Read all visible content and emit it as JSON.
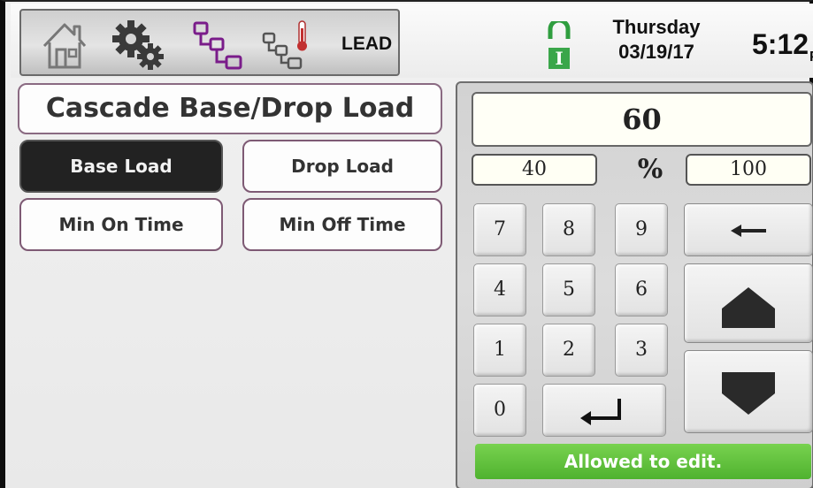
{
  "header": {
    "mode_label": "LEAD",
    "day": "Thursday",
    "date": "03/19/17",
    "time": "5:12",
    "time_suffix": "PM",
    "status_icon_letter": "I",
    "status_color": "#3aa64a"
  },
  "page": {
    "title": "Cascade Base/Drop Load"
  },
  "menu": {
    "base_load": "Base Load",
    "drop_load": "Drop Load",
    "min_on_time": "Min On Time",
    "min_off_time": "Min Off Time",
    "selected": "Base Load"
  },
  "keypad": {
    "value": "60",
    "min": "40",
    "max": "100",
    "unit": "%",
    "keys": {
      "k7": "7",
      "k8": "8",
      "k9": "9",
      "k4": "4",
      "k5": "5",
      "k6": "6",
      "k1": "1",
      "k2": "2",
      "k3": "3",
      "k0": "0"
    },
    "edit_status": "Allowed to edit.",
    "edit_status_color": "#5cc23a"
  },
  "icons": {
    "home": "home-icon",
    "settings": "gear-icon",
    "cascade": "cascade-icon",
    "cascade_temp": "cascade-temperature-icon",
    "status": "input-status-icon",
    "backspace": "arrow-left-icon",
    "enter": "enter-icon",
    "up": "arrow-up-icon",
    "down": "arrow-down-icon"
  }
}
